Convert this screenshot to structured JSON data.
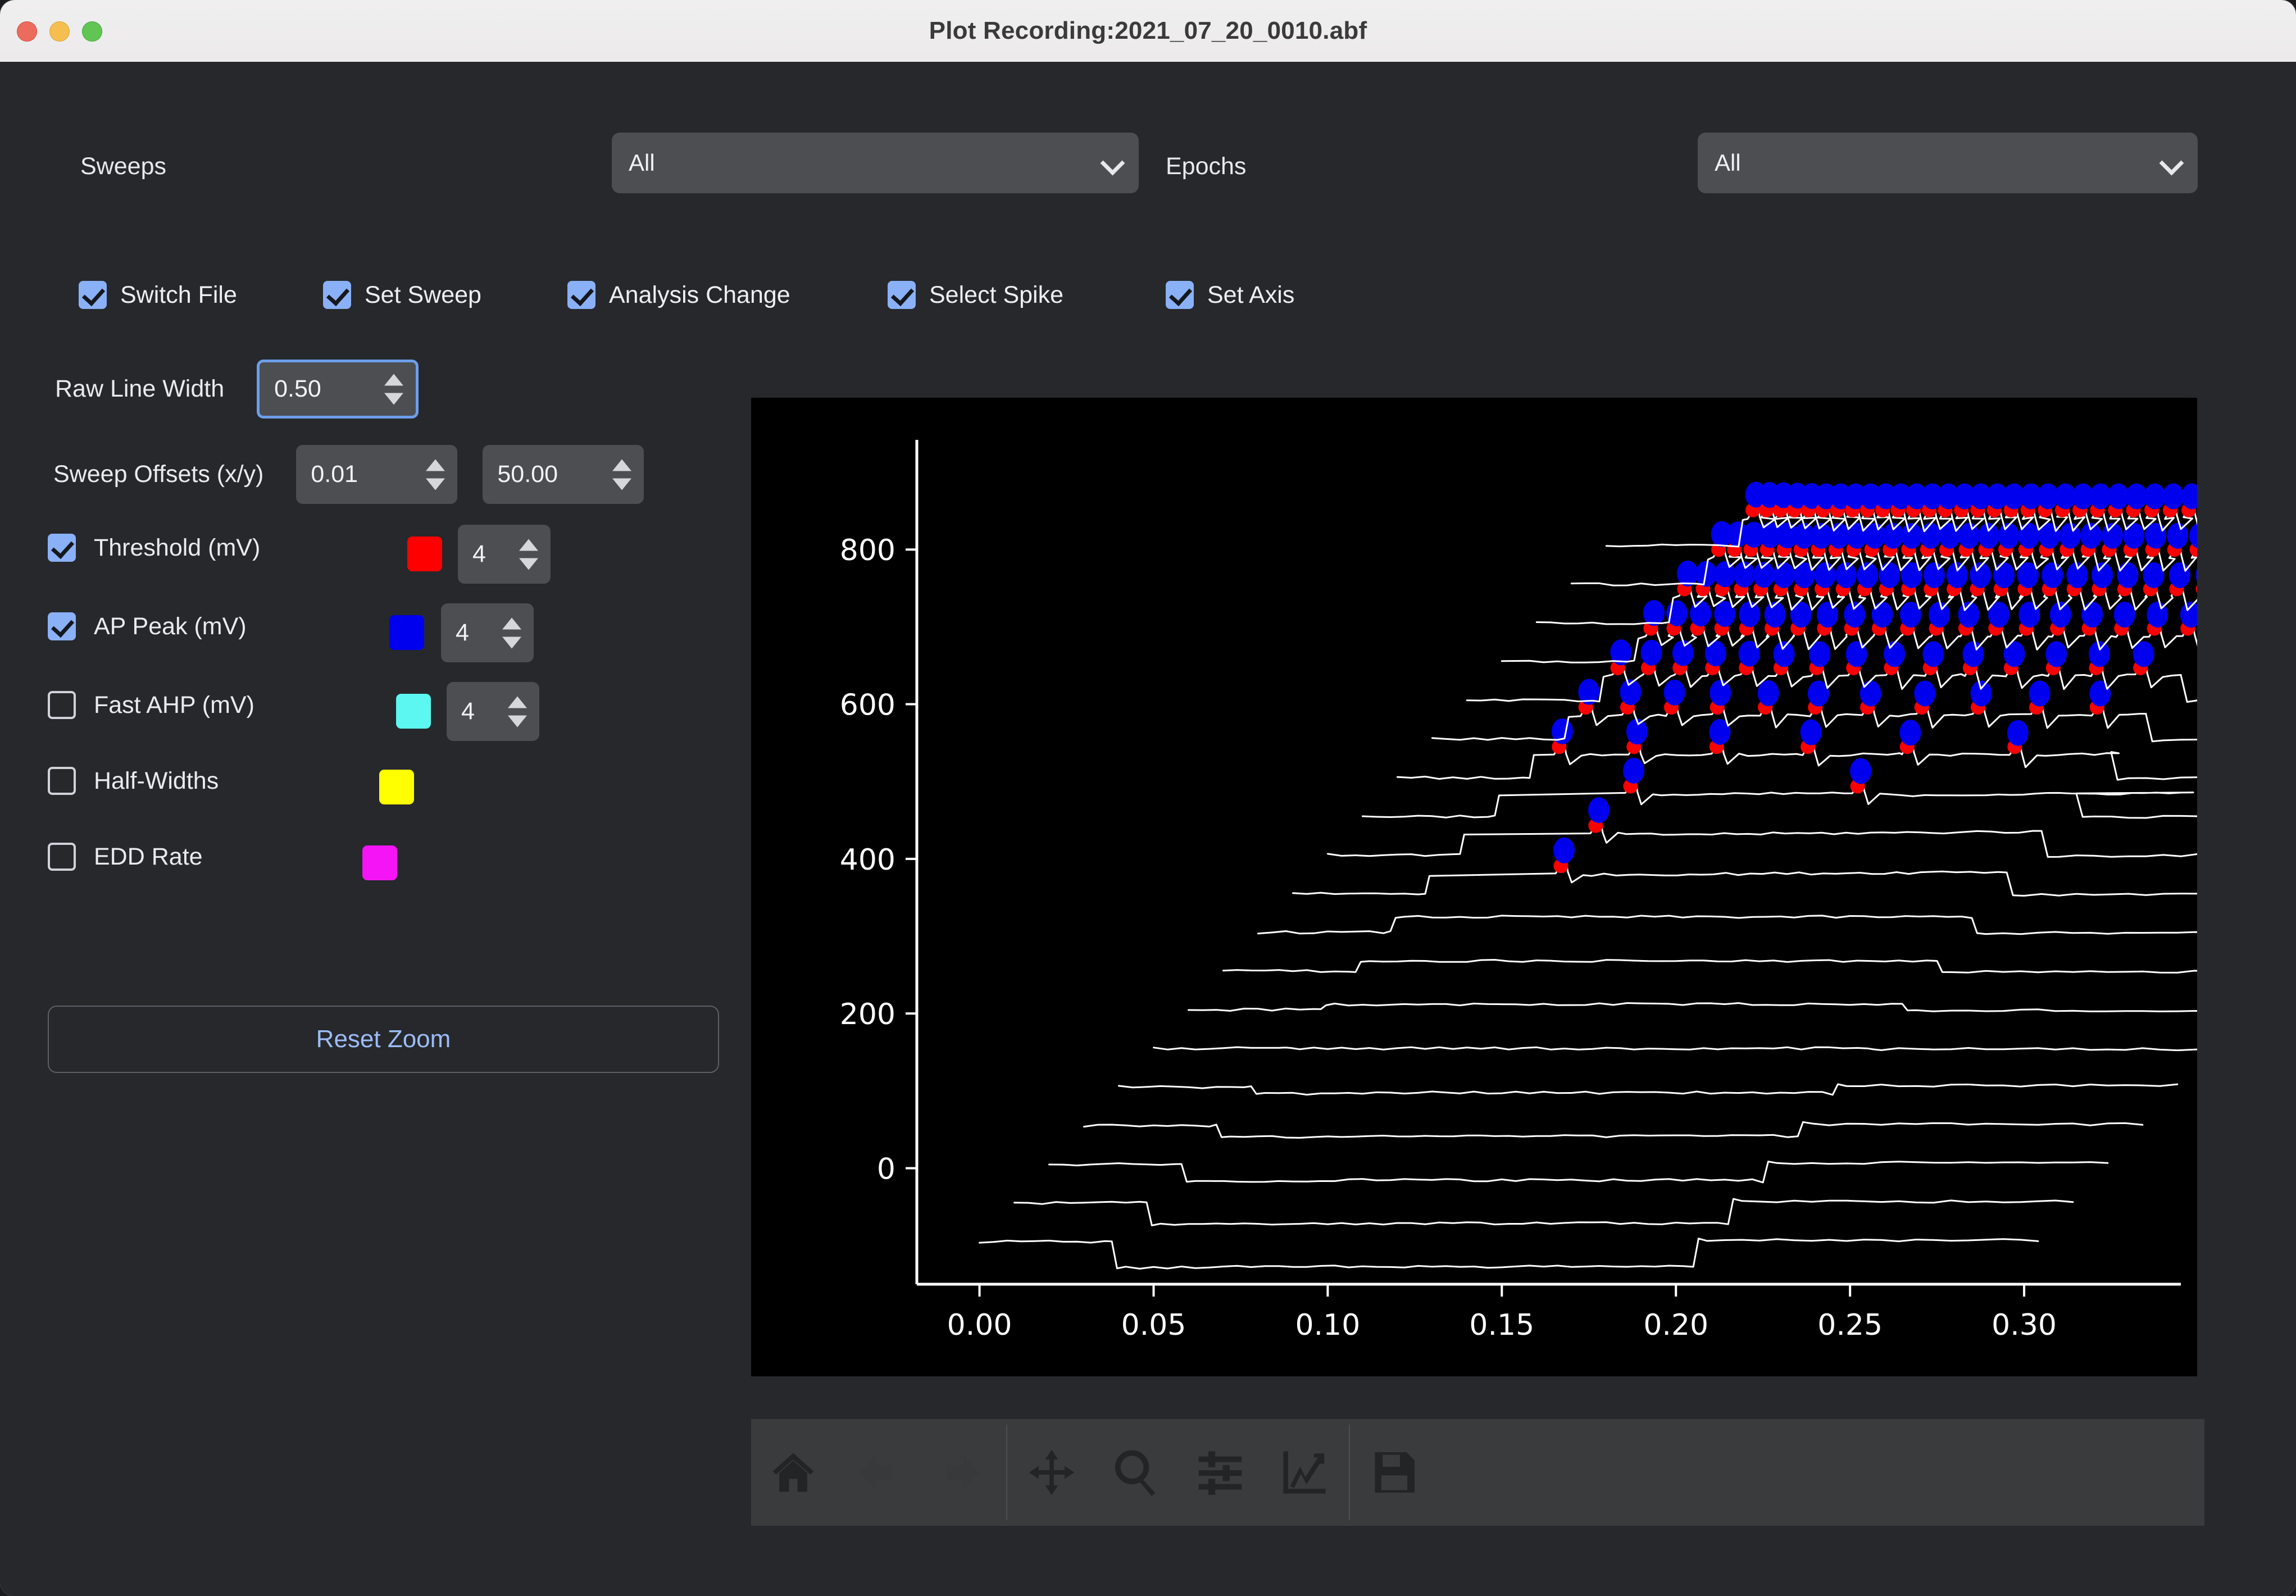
{
  "window": {
    "title": "Plot Recording:2021_07_20_0010.abf",
    "traffic_lights": [
      "close-button",
      "minimize-button",
      "maximize-button"
    ]
  },
  "selectors": {
    "sweeps_label": "Sweeps",
    "sweeps_value": "All",
    "epochs_label": "Epochs",
    "epochs_value": "All"
  },
  "event_checkboxes": [
    {
      "label": "Switch File",
      "checked": true
    },
    {
      "label": "Set Sweep",
      "checked": true
    },
    {
      "label": "Analysis Change",
      "checked": true
    },
    {
      "label": "Select Spike",
      "checked": true
    },
    {
      "label": "Set Axis",
      "checked": true
    }
  ],
  "controls": {
    "raw_line_width_label": "Raw Line Width",
    "raw_line_width_value": "0.50",
    "sweep_offsets_label": "Sweep Offsets (x/y)",
    "sweep_offset_x": "0.01",
    "sweep_offset_y": "50.00",
    "reset_zoom_label": "Reset Zoom"
  },
  "analysis_options": [
    {
      "label": "Threshold (mV)",
      "checked": true,
      "color": "#FF0000",
      "count": "4",
      "has_count": true
    },
    {
      "label": "AP Peak (mV)",
      "checked": true,
      "color": "#0000EE",
      "count": "4",
      "has_count": true
    },
    {
      "label": "Fast AHP (mV)",
      "checked": false,
      "color": "#5CF7F0",
      "count": "4",
      "has_count": true
    },
    {
      "label": "Half-Widths",
      "checked": false,
      "color": "#FFFF00",
      "count": "",
      "has_count": false
    },
    {
      "label": "EDD Rate",
      "checked": false,
      "color": "#F514F5",
      "count": "",
      "has_count": false
    }
  ],
  "toolbar": {
    "buttons": [
      {
        "name": "home-icon",
        "title": "Home",
        "enabled": true
      },
      {
        "name": "back-arrow-icon",
        "title": "Back",
        "enabled": false
      },
      {
        "name": "forward-arrow-icon",
        "title": "Forward",
        "enabled": false
      },
      {
        "name": "pan-move-icon",
        "title": "Pan",
        "enabled": true
      },
      {
        "name": "magnifier-zoom-icon",
        "title": "Zoom",
        "enabled": true
      },
      {
        "name": "sliders-configure-icon",
        "title": "Configure subplots",
        "enabled": true
      },
      {
        "name": "axis-edit-icon",
        "title": "Edit axis",
        "enabled": true
      },
      {
        "name": "save-floppy-icon",
        "title": "Save figure",
        "enabled": true
      }
    ]
  },
  "chart_data": {
    "type": "line",
    "title": "",
    "xlabel": "",
    "ylabel": "",
    "xlim": [
      -0.018,
      0.345
    ],
    "ylim": [
      -150,
      920
    ],
    "xticks": [
      0.0,
      0.05,
      0.1,
      0.15,
      0.2,
      0.25,
      0.3
    ],
    "xticklabels": [
      "0.00",
      "0.05",
      "0.10",
      "0.15",
      "0.20",
      "0.25",
      "0.30"
    ],
    "yticks": [
      0,
      200,
      400,
      600,
      800
    ],
    "yticklabels": [
      "0",
      "200",
      "400",
      "600",
      "800"
    ],
    "grid": false,
    "legend": false,
    "background": "#000000",
    "trace_color": "#FFFFFF",
    "threshold_marker_color": "#FF0000",
    "ap_peak_marker_color": "#0000EE",
    "sweep_offset_x": 0.01,
    "sweep_offset_y": 50.0,
    "n_sweeps": 19,
    "description": "Stacked current-clamp sweeps offset by 0.01 s in x and 50 mV in y; white raw traces with red threshold markers and blue AP-peak markers overlaid on each detected spike.",
    "series": [
      {
        "name": "sweep-1",
        "y_offset": -95,
        "x_offset": 0.0,
        "step_sign": -1,
        "step_amp": -34,
        "n_spikes": 0
      },
      {
        "name": "sweep-2",
        "y_offset": -45,
        "x_offset": 0.01,
        "step_sign": -1,
        "step_amp": -28,
        "n_spikes": 0
      },
      {
        "name": "sweep-3",
        "y_offset": 5,
        "x_offset": 0.02,
        "step_sign": -1,
        "step_amp": -22,
        "n_spikes": 0
      },
      {
        "name": "sweep-4",
        "y_offset": 55,
        "x_offset": 0.03,
        "step_sign": -1,
        "step_amp": -15,
        "n_spikes": 0
      },
      {
        "name": "sweep-5",
        "y_offset": 105,
        "x_offset": 0.04,
        "step_sign": -1,
        "step_amp": -9,
        "n_spikes": 0
      },
      {
        "name": "sweep-6",
        "y_offset": 155,
        "x_offset": 0.05,
        "step_sign": 0,
        "step_amp": 0,
        "n_spikes": 0
      },
      {
        "name": "sweep-7",
        "y_offset": 205,
        "x_offset": 0.06,
        "step_sign": 1,
        "step_amp": 7,
        "n_spikes": 0
      },
      {
        "name": "sweep-8",
        "y_offset": 255,
        "x_offset": 0.07,
        "step_sign": 1,
        "step_amp": 13,
        "n_spikes": 0
      },
      {
        "name": "sweep-9",
        "y_offset": 305,
        "x_offset": 0.08,
        "step_sign": 1,
        "step_amp": 20,
        "n_spikes": 0
      },
      {
        "name": "sweep-10",
        "y_offset": 355,
        "x_offset": 0.09,
        "step_sign": 1,
        "step_amp": 24,
        "n_spikes": 1
      },
      {
        "name": "sweep-11",
        "y_offset": 405,
        "x_offset": 0.1,
        "step_sign": 1,
        "step_amp": 26,
        "n_spikes": 1
      },
      {
        "name": "sweep-12",
        "y_offset": 455,
        "x_offset": 0.11,
        "step_sign": 1,
        "step_amp": 27,
        "n_spikes": 2
      },
      {
        "name": "sweep-13",
        "y_offset": 505,
        "x_offset": 0.12,
        "step_sign": 1,
        "step_amp": 28,
        "n_spikes": 6
      },
      {
        "name": "sweep-14",
        "y_offset": 555,
        "x_offset": 0.13,
        "step_sign": 1,
        "step_amp": 29,
        "n_spikes": 12
      },
      {
        "name": "sweep-15",
        "y_offset": 605,
        "x_offset": 0.14,
        "step_sign": 1,
        "step_amp": 30,
        "n_spikes": 17
      },
      {
        "name": "sweep-16",
        "y_offset": 655,
        "x_offset": 0.15,
        "step_sign": 1,
        "step_amp": 31,
        "n_spikes": 23
      },
      {
        "name": "sweep-17",
        "y_offset": 705,
        "x_offset": 0.16,
        "step_sign": 1,
        "step_amp": 32,
        "n_spikes": 29
      },
      {
        "name": "sweep-18",
        "y_offset": 755,
        "x_offset": 0.17,
        "step_sign": 1,
        "step_amp": 33,
        "n_spikes": 34
      },
      {
        "name": "sweep-19",
        "y_offset": 805,
        "x_offset": 0.18,
        "step_sign": 1,
        "step_amp": 34,
        "n_spikes": 40
      }
    ]
  }
}
